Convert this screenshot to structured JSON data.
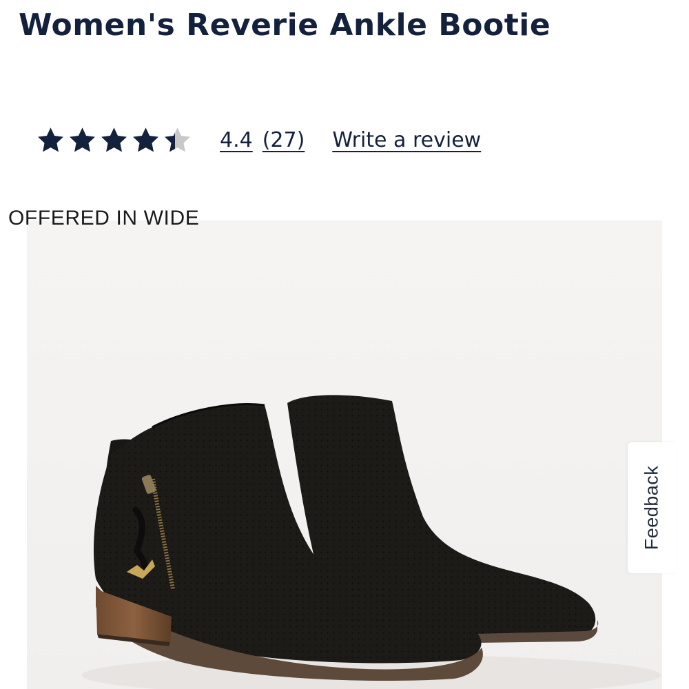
{
  "product": {
    "title": "Women's Reverie Ankle Bootie"
  },
  "rating": {
    "stars": 4.4,
    "max_stars": 5,
    "value_text": "4.4",
    "count_text": "(27)",
    "write_review_label": "Write a review",
    "star_color": "#14213d",
    "star_empty_color": "#c8c8c8"
  },
  "image": {
    "badge_text": "OFFERED IN WIDE",
    "background_color": "#f4f2f0",
    "subject": "black perforated suede ankle booties with side zipper"
  },
  "feedback": {
    "label": "Feedback"
  }
}
